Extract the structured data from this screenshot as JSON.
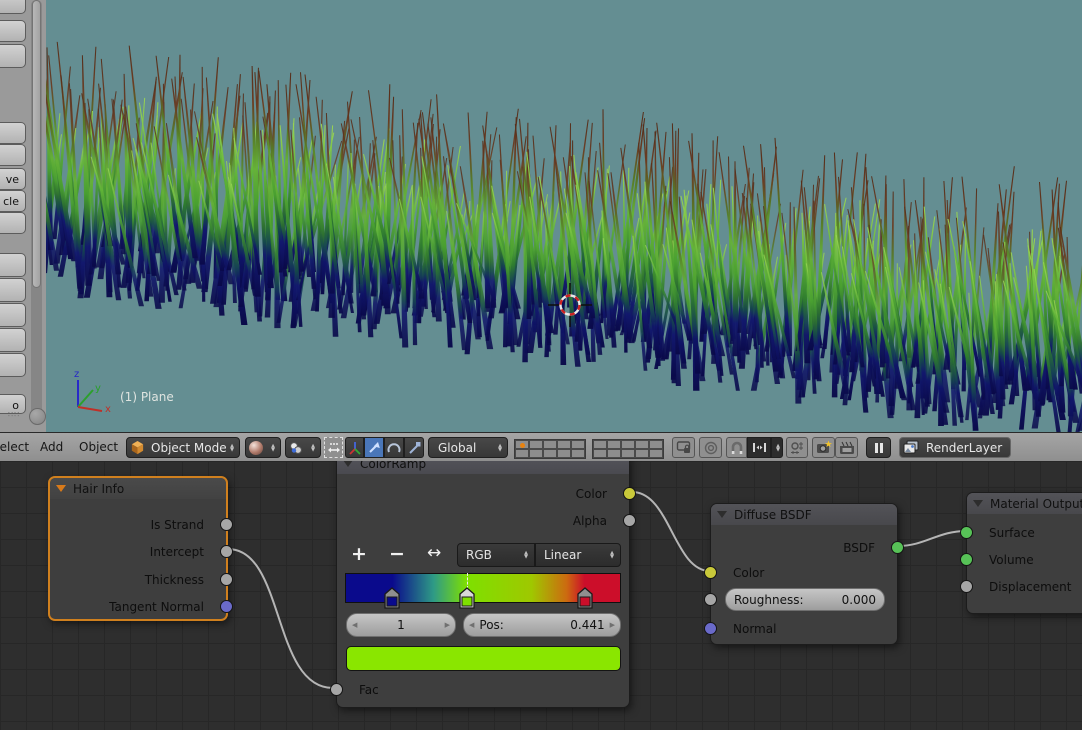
{
  "header": {
    "menus": [
      "Select",
      "Add",
      "Object"
    ],
    "mode_selector": "Object Mode",
    "orientation": "Global",
    "render_layer": "RenderLayer",
    "layers": {
      "groups": 2,
      "cells_per_group": 10,
      "active_cell": 0
    }
  },
  "toolshelf": {
    "partial_labels": [
      "ve",
      "cle",
      "o"
    ]
  },
  "viewport": {
    "object_info": "(1) Plane",
    "axis_labels": {
      "x": "x",
      "y": "y",
      "z": "z"
    },
    "background": "#648e92"
  },
  "node_editor": {
    "nodes": {
      "hair_info": {
        "title": "Hair Info",
        "outputs": [
          "Is Strand",
          "Intercept",
          "Thickness",
          "Tangent Normal"
        ],
        "selected": true
      },
      "color_ramp": {
        "title": "ColorRamp",
        "outputs": [
          "Color",
          "Alpha"
        ],
        "add_label": "+",
        "delete_label": "−",
        "flip_label": "↔",
        "color_mode": "RGB",
        "interpolation": "Linear",
        "active_index": "1",
        "pos_label": "Pos:",
        "pos_value": "0.441",
        "input_label": "Fac",
        "active_color": "#8ae600",
        "stops": [
          {
            "pos": 0.17,
            "color": "#0a0a8c",
            "selected": false
          },
          {
            "pos": 0.441,
            "color": "#7ee000",
            "selected": true
          },
          {
            "pos": 0.87,
            "color": "#cc0e2a",
            "selected": false
          }
        ]
      },
      "diffuse_bsdf": {
        "title": "Diffuse BSDF",
        "output": "BSDF",
        "inputs": {
          "color": "Color",
          "roughness_label": "Roughness:",
          "roughness_value": "0.000",
          "normal": "Normal"
        }
      },
      "material_output": {
        "title": "Material Output",
        "inputs": [
          "Surface",
          "Volume",
          "Displacement"
        ]
      }
    },
    "links": [
      {
        "from": "Hair Info.Intercept",
        "to": "ColorRamp.Fac"
      },
      {
        "from": "ColorRamp.Color",
        "to": "Diffuse BSDF.Color"
      },
      {
        "from": "Diffuse BSDF.BSDF",
        "to": "Material Output.Surface"
      }
    ]
  }
}
